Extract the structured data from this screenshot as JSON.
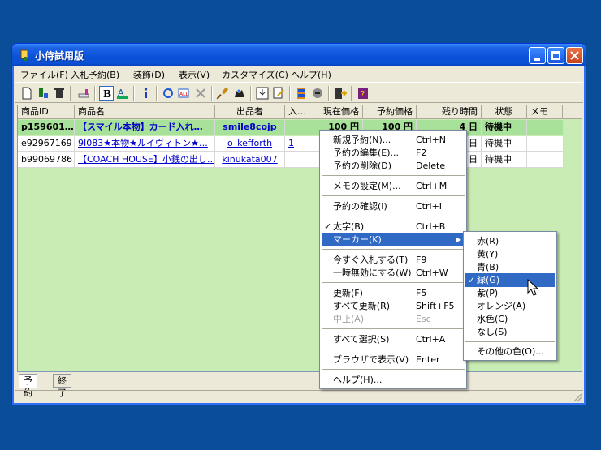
{
  "window": {
    "title": "小侍試用版"
  },
  "menubar": [
    "ファイル(F)",
    "入札予約(B)",
    "装飾(D)",
    "表示(V)",
    "カスタマイズ(C)",
    "ヘルプ(H)"
  ],
  "columns": [
    "商品ID",
    "商品名",
    "出品者",
    "入…",
    "現在価格",
    "予約価格",
    "残り時間",
    "状態",
    "メモ"
  ],
  "rows": [
    {
      "id": "p159601…",
      "name": "【スマイル本物】カード入れ…",
      "seller": "smile8cojp",
      "bids": "",
      "price": "100 円",
      "reserve": "100 円",
      "remain": "4 日",
      "state": "待機中",
      "memo": ""
    },
    {
      "id": "e92967169",
      "name": "9I083★本物★ルイヴィトン★…",
      "seller": "o_kefforth",
      "bids": "1",
      "price": "",
      "reserve": "",
      "remain": "日",
      "state": "待機中",
      "memo": ""
    },
    {
      "id": "b99069786",
      "name": "【COACH HOUSE】小銭の出し…",
      "seller": "kinukata007",
      "bids": "",
      "price": "",
      "reserve": "",
      "remain": "日",
      "state": "待機中",
      "memo": ""
    }
  ],
  "tabs": [
    "予約",
    "終了"
  ],
  "context_menu": [
    {
      "label": "新規予約(N)...",
      "shortcut": "Ctrl+N"
    },
    {
      "label": "予約の編集(E)...",
      "shortcut": "F2"
    },
    {
      "label": "予約の削除(D)",
      "shortcut": "Delete"
    },
    {
      "label": "メモの設定(M)...",
      "shortcut": "Ctrl+M"
    },
    {
      "label": "予約の確認(I)",
      "shortcut": "Ctrl+I"
    },
    {
      "label": "太字(B)",
      "shortcut": "Ctrl+B",
      "checked": "✓"
    },
    {
      "label": "マーカー(K)",
      "shortcut": ""
    },
    {
      "label": "今すぐ入札する(T)",
      "shortcut": "F9"
    },
    {
      "label": "一時無効にする(W)",
      "shortcut": "Ctrl+W"
    },
    {
      "label": "更新(F)",
      "shortcut": "F5"
    },
    {
      "label": "すべて更新(R)",
      "shortcut": "Shift+F5"
    },
    {
      "label": "中止(A)",
      "shortcut": "Esc"
    },
    {
      "label": "すべて選択(S)",
      "shortcut": "Ctrl+A"
    },
    {
      "label": "ブラウザで表示(V)",
      "shortcut": "Enter"
    },
    {
      "label": "ヘルプ(H)...",
      "shortcut": ""
    }
  ],
  "submenu": [
    {
      "label": "赤(R)"
    },
    {
      "label": "黄(Y)"
    },
    {
      "label": "青(B)"
    },
    {
      "label": "緑(G)",
      "checked": "✓"
    },
    {
      "label": "紫(P)"
    },
    {
      "label": "オレンジ(A)"
    },
    {
      "label": "水色(C)"
    },
    {
      "label": "なし(S)"
    },
    {
      "label": "その他の色(O)..."
    }
  ],
  "colors": {
    "desktop": "#0a4d98",
    "list_bg": "#c8ecb4",
    "selected_row": "#a8e19a",
    "highlight": "#316ac5"
  }
}
